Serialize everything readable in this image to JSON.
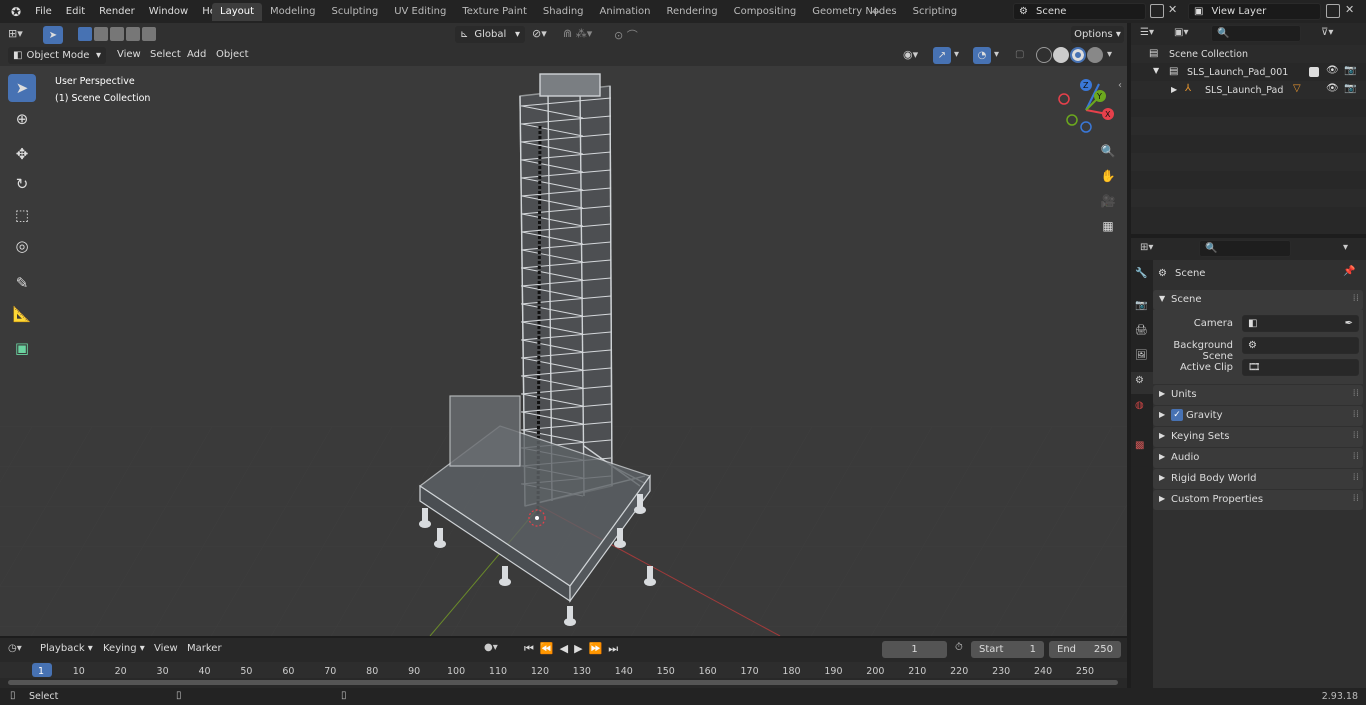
{
  "app": {
    "version": "2.93.18"
  },
  "menu": {
    "file": "File",
    "edit": "Edit",
    "render": "Render",
    "window": "Window",
    "help": "Help"
  },
  "workspaces": [
    "Layout",
    "Modeling",
    "Sculpting",
    "UV Editing",
    "Texture Paint",
    "Shading",
    "Animation",
    "Rendering",
    "Compositing",
    "Geometry Nodes",
    "Scripting"
  ],
  "active_workspace": "Layout",
  "scene_field": "Scene",
  "view_layer_field": "View Layer",
  "viewport_header": {
    "mode": "Object Mode",
    "view": "View",
    "select": "Select",
    "add": "Add",
    "object": "Object",
    "transform_orientation": "Global",
    "options": "Options"
  },
  "viewport": {
    "perspective_label": "User Perspective",
    "collection_label": "(1) Scene Collection",
    "gizmo_axes": {
      "x": "X",
      "y": "Y",
      "z": "Z"
    }
  },
  "outliner": {
    "root": "Scene Collection",
    "items": [
      {
        "label": "SLS_Launch_Pad_001",
        "type": "collection"
      },
      {
        "label": "SLS_Launch_Pad",
        "type": "object"
      }
    ]
  },
  "properties": {
    "header": "Scene",
    "panel_title": "Scene",
    "fields": [
      {
        "label": "Camera"
      },
      {
        "label": "Background Scene"
      },
      {
        "label": "Active Clip"
      }
    ],
    "sections": [
      "Units",
      "Gravity",
      "Keying Sets",
      "Audio",
      "Rigid Body World",
      "Custom Properties"
    ],
    "gravity_checked": true
  },
  "timeline": {
    "playback": "Playback",
    "keying": "Keying",
    "view": "View",
    "marker": "Marker",
    "current_frame": "1",
    "start_label": "Start",
    "start_value": "1",
    "end_label": "End",
    "end_value": "250",
    "ticks": [
      "1",
      "10",
      "20",
      "30",
      "40",
      "50",
      "60",
      "70",
      "80",
      "90",
      "100",
      "110",
      "120",
      "130",
      "140",
      "150",
      "160",
      "170",
      "180",
      "190",
      "200",
      "210",
      "220",
      "230",
      "240",
      "250"
    ]
  },
  "status_bar": {
    "select": "Select",
    "version": "2.93.18"
  },
  "colors": {
    "accent": "#4772b3",
    "x_axis": "#e6404b",
    "y_axis": "#6ba81e",
    "z_axis": "#3a78d8",
    "object_orange": "#e8962f"
  }
}
